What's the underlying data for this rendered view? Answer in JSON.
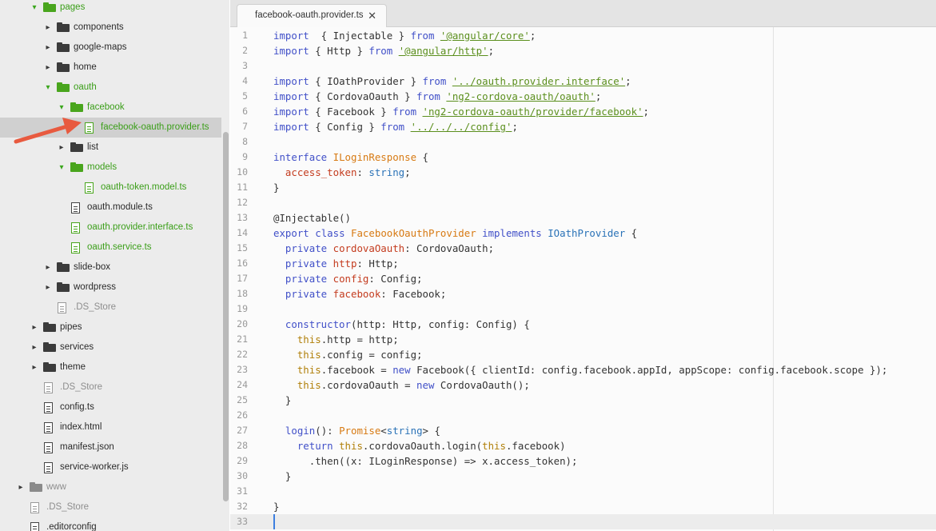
{
  "sidebar": {
    "items": [
      {
        "label": "pages",
        "kind": "folder",
        "color": "green",
        "arrow": "▾",
        "arrow_color": "green",
        "depth": 0
      },
      {
        "label": "components",
        "kind": "folder",
        "color": "dark",
        "arrow": "▸",
        "arrow_color": "dark",
        "depth": 1
      },
      {
        "label": "google-maps",
        "kind": "folder",
        "color": "dark",
        "arrow": "▸",
        "arrow_color": "dark",
        "depth": 1
      },
      {
        "label": "home",
        "kind": "folder",
        "color": "dark",
        "arrow": "▸",
        "arrow_color": "dark",
        "depth": 1
      },
      {
        "label": "oauth",
        "kind": "folder",
        "color": "green",
        "arrow": "▾",
        "arrow_color": "green",
        "depth": 1
      },
      {
        "label": "facebook",
        "kind": "folder",
        "color": "green",
        "arrow": "▾",
        "arrow_color": "green",
        "depth": 2
      },
      {
        "label": "facebook-oauth.provider.ts",
        "kind": "file",
        "color": "green",
        "arrow": "",
        "depth": 3,
        "selected": true
      },
      {
        "label": "list",
        "kind": "folder",
        "color": "dark",
        "arrow": "▸",
        "arrow_color": "dark",
        "depth": 2
      },
      {
        "label": "models",
        "kind": "folder",
        "color": "green",
        "arrow": "▾",
        "arrow_color": "green",
        "depth": 2
      },
      {
        "label": "oauth-token.model.ts",
        "kind": "file",
        "color": "green",
        "arrow": "",
        "depth": 3
      },
      {
        "label": "oauth.module.ts",
        "kind": "file",
        "color": "dark",
        "arrow": "",
        "depth": 2
      },
      {
        "label": "oauth.provider.interface.ts",
        "kind": "file",
        "color": "green",
        "arrow": "",
        "depth": 2
      },
      {
        "label": "oauth.service.ts",
        "kind": "file",
        "color": "green",
        "arrow": "",
        "depth": 2
      },
      {
        "label": "slide-box",
        "kind": "folder",
        "color": "dark",
        "arrow": "▸",
        "arrow_color": "dark",
        "depth": 1
      },
      {
        "label": "wordpress",
        "kind": "folder",
        "color": "dark",
        "arrow": "▸",
        "arrow_color": "dark",
        "depth": 1
      },
      {
        "label": ".DS_Store",
        "kind": "file",
        "color": "gray",
        "arrow": "",
        "depth": 1
      },
      {
        "label": "pipes",
        "kind": "folder",
        "color": "dark",
        "arrow": "▸",
        "arrow_color": "dark",
        "depth": 0
      },
      {
        "label": "services",
        "kind": "folder",
        "color": "dark",
        "arrow": "▸",
        "arrow_color": "dark",
        "depth": 0
      },
      {
        "label": "theme",
        "kind": "folder",
        "color": "dark",
        "arrow": "▸",
        "arrow_color": "dark",
        "depth": 0
      },
      {
        "label": ".DS_Store",
        "kind": "file",
        "color": "gray",
        "arrow": "",
        "depth": 0
      },
      {
        "label": "config.ts",
        "kind": "file",
        "color": "dark",
        "arrow": "",
        "depth": 0
      },
      {
        "label": "index.html",
        "kind": "file",
        "color": "dark",
        "arrow": "",
        "depth": 0
      },
      {
        "label": "manifest.json",
        "kind": "file",
        "color": "dark",
        "arrow": "",
        "depth": 0
      },
      {
        "label": "service-worker.js",
        "kind": "file",
        "color": "dark",
        "arrow": "",
        "depth": 0
      },
      {
        "label": "www",
        "kind": "folder",
        "color": "gray",
        "arrow": "▸",
        "arrow_color": "gray",
        "depth": -1
      },
      {
        "label": ".DS_Store",
        "kind": "file",
        "color": "gray",
        "arrow": "",
        "depth": -1
      },
      {
        "label": ".editorconfig",
        "kind": "file",
        "color": "dark",
        "arrow": "",
        "depth": -1
      }
    ]
  },
  "tab": {
    "label": "facebook-oauth.provider.ts",
    "close_glyph": "✕"
  },
  "editor": {
    "current_line": 33,
    "lines": [
      [
        [
          "kw",
          "import"
        ],
        [
          "",
          "  { Injectable } "
        ],
        [
          "kw",
          "from"
        ],
        [
          "",
          " "
        ],
        [
          "str",
          "'@angular/core'"
        ],
        [
          "",
          ";"
        ]
      ],
      [
        [
          "kw",
          "import"
        ],
        [
          "",
          " { Http } "
        ],
        [
          "kw",
          "from"
        ],
        [
          "",
          " "
        ],
        [
          "str",
          "'@angular/http'"
        ],
        [
          "",
          ";"
        ]
      ],
      [],
      [
        [
          "kw",
          "import"
        ],
        [
          "",
          " { IOathProvider } "
        ],
        [
          "kw",
          "from"
        ],
        [
          "",
          " "
        ],
        [
          "str",
          "'../oauth.provider.interface'"
        ],
        [
          "",
          ";"
        ]
      ],
      [
        [
          "kw",
          "import"
        ],
        [
          "",
          " { CordovaOauth } "
        ],
        [
          "kw",
          "from"
        ],
        [
          "",
          " "
        ],
        [
          "str",
          "'ng2-cordova-oauth/oauth'"
        ],
        [
          "",
          ";"
        ]
      ],
      [
        [
          "kw",
          "import"
        ],
        [
          "",
          " { Facebook } "
        ],
        [
          "kw",
          "from"
        ],
        [
          "",
          " "
        ],
        [
          "str",
          "'ng2-cordova-oauth/provider/facebook'"
        ],
        [
          "",
          ";"
        ]
      ],
      [
        [
          "kw",
          "import"
        ],
        [
          "",
          " { Config } "
        ],
        [
          "kw",
          "from"
        ],
        [
          "",
          " "
        ],
        [
          "str",
          "'../../../config'"
        ],
        [
          "",
          ";"
        ]
      ],
      [],
      [
        [
          "kw",
          "interface"
        ],
        [
          "",
          " "
        ],
        [
          "tp",
          "ILoginResponse"
        ],
        [
          "",
          " {"
        ]
      ],
      [
        [
          "",
          "  "
        ],
        [
          "pr",
          "access_token"
        ],
        [
          "",
          ": "
        ],
        [
          "bt",
          "string"
        ],
        [
          "",
          ";"
        ]
      ],
      [
        [
          "",
          "}"
        ]
      ],
      [],
      [
        [
          "",
          "@Injectable()"
        ]
      ],
      [
        [
          "kw",
          "export"
        ],
        [
          "",
          " "
        ],
        [
          "kw",
          "class"
        ],
        [
          "",
          " "
        ],
        [
          "tp",
          "FacebookOauthProvider"
        ],
        [
          "",
          " "
        ],
        [
          "kw",
          "implements"
        ],
        [
          "",
          " "
        ],
        [
          "bt",
          "IOathProvider"
        ],
        [
          "",
          " {"
        ]
      ],
      [
        [
          "",
          "  "
        ],
        [
          "kw",
          "private"
        ],
        [
          "",
          " "
        ],
        [
          "pr",
          "cordovaOauth"
        ],
        [
          "",
          ": CordovaOauth;"
        ]
      ],
      [
        [
          "",
          "  "
        ],
        [
          "kw",
          "private"
        ],
        [
          "",
          " "
        ],
        [
          "pr",
          "http"
        ],
        [
          "",
          ": Http;"
        ]
      ],
      [
        [
          "",
          "  "
        ],
        [
          "kw",
          "private"
        ],
        [
          "",
          " "
        ],
        [
          "pr",
          "config"
        ],
        [
          "",
          ": Config;"
        ]
      ],
      [
        [
          "",
          "  "
        ],
        [
          "kw",
          "private"
        ],
        [
          "",
          " "
        ],
        [
          "pr",
          "facebook"
        ],
        [
          "",
          ": Facebook;"
        ]
      ],
      [],
      [
        [
          "",
          "  "
        ],
        [
          "kw",
          "constructor"
        ],
        [
          "",
          "(http: Http, config: Config) {"
        ]
      ],
      [
        [
          "",
          "    "
        ],
        [
          "th",
          "this"
        ],
        [
          "",
          ".http = http;"
        ]
      ],
      [
        [
          "",
          "    "
        ],
        [
          "th",
          "this"
        ],
        [
          "",
          ".config = config;"
        ]
      ],
      [
        [
          "",
          "    "
        ],
        [
          "th",
          "this"
        ],
        [
          "",
          ".facebook = "
        ],
        [
          "kw",
          "new"
        ],
        [
          "",
          " Facebook({ clientId: config.facebook.appId, appScope: config.facebook.scope });"
        ]
      ],
      [
        [
          "",
          "    "
        ],
        [
          "th",
          "this"
        ],
        [
          "",
          ".cordovaOauth = "
        ],
        [
          "kw",
          "new"
        ],
        [
          "",
          " CordovaOauth();"
        ]
      ],
      [
        [
          "",
          "  }"
        ]
      ],
      [],
      [
        [
          "",
          "  "
        ],
        [
          "kw",
          "login"
        ],
        [
          "",
          "(): "
        ],
        [
          "tp",
          "Promise"
        ],
        [
          "",
          "<"
        ],
        [
          "bt",
          "string"
        ],
        [
          "",
          "> {"
        ]
      ],
      [
        [
          "",
          "    "
        ],
        [
          "kw",
          "return"
        ],
        [
          "",
          " "
        ],
        [
          "th",
          "this"
        ],
        [
          "",
          ".cordovaOauth.login("
        ],
        [
          "th",
          "this"
        ],
        [
          "",
          ".facebook)"
        ]
      ],
      [
        [
          "",
          "      .then((x: ILoginResponse) => x.access_token);"
        ]
      ],
      [
        [
          "",
          "  }"
        ]
      ],
      [],
      [
        [
          "",
          "}"
        ]
      ],
      []
    ]
  }
}
